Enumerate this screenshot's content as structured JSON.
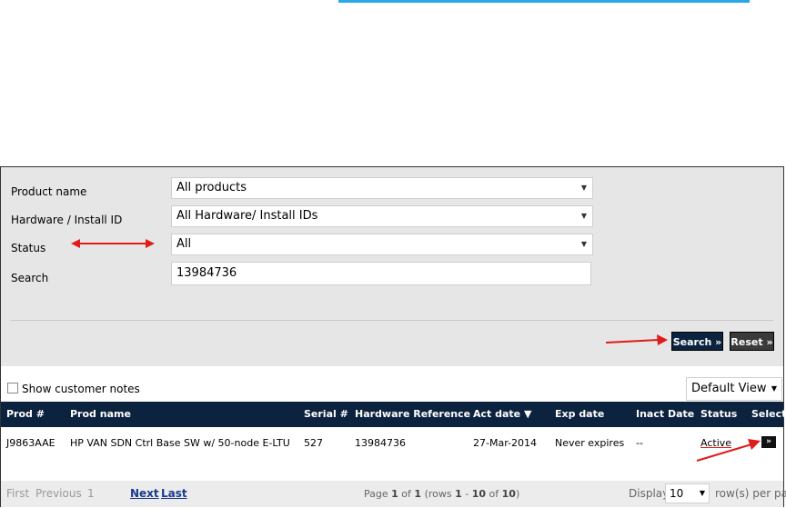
{
  "filters": {
    "product_name": {
      "label": "Product name",
      "value": "All products"
    },
    "hardware_id": {
      "label": "Hardware / Install ID",
      "value": "All Hardware/ Install IDs"
    },
    "status": {
      "label": "Status",
      "value": "All"
    },
    "search": {
      "label": "Search",
      "value": "13984736"
    }
  },
  "buttons": {
    "search": "Search »",
    "reset": "Reset »"
  },
  "notes": {
    "label": "Show customer notes",
    "checked": false
  },
  "view": {
    "value": "Default View"
  },
  "table": {
    "columns": [
      "Prod #",
      "Prod name",
      "Serial #",
      "Hardware Reference",
      "Act date ▼",
      "Exp date",
      "Inact Date",
      "Status",
      "Select"
    ],
    "rows": [
      {
        "prod": "J9863AAE",
        "name": "HP VAN SDN Ctrl Base SW w/ 50-node E-LTU",
        "serial": "527",
        "hwref": "13984736",
        "act": "27-Mar-2014",
        "exp": "Never expires",
        "inact": "--",
        "status": "Active",
        "select": "»"
      }
    ]
  },
  "pager": {
    "first": "First",
    "previous": "Previous",
    "page_num": "1",
    "next": "Next",
    "last": "Last",
    "info": {
      "page_word": "Page",
      "page": "1",
      "of_word": "of",
      "pages": "1",
      "rows_word": "(rows",
      "start": "1",
      "dash": "-",
      "end": "10",
      "of2": "of",
      "total": "10",
      "close": ")"
    },
    "display_label": "Display",
    "rows_per_page": "10",
    "per_page_label": "row(s) per page"
  },
  "colors": {
    "header_bg": "#0c2340",
    "accent_top": "#2aa7e6",
    "annotation": "#e01b1b"
  }
}
